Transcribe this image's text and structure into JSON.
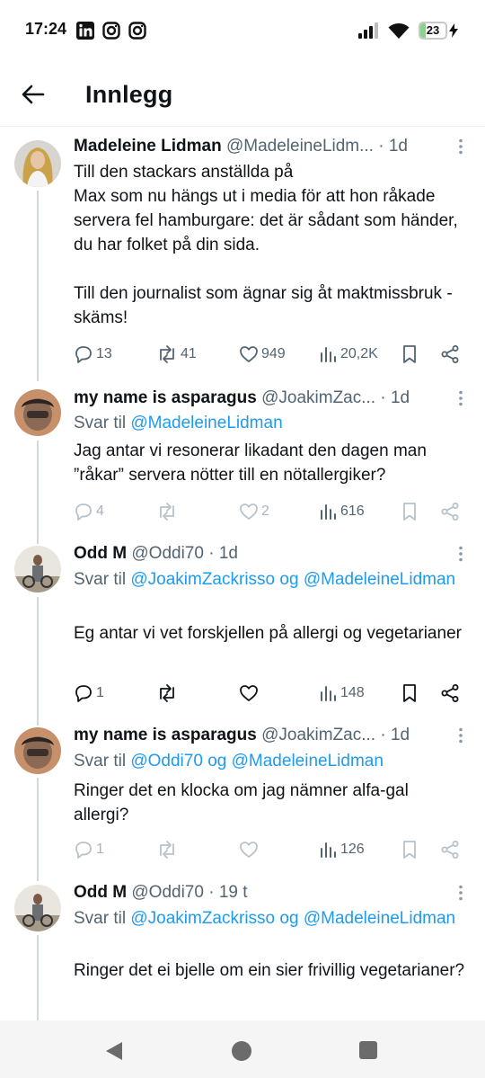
{
  "status_bar": {
    "time": "17:24",
    "battery": "23",
    "battery_level": 0.23,
    "icons": [
      "linkedin-icon",
      "instagram-icon",
      "instagram-icon",
      "signal-icon",
      "wifi-icon",
      "battery-icon",
      "charging-icon"
    ]
  },
  "header": {
    "title": "Innlegg"
  },
  "colors": {
    "link": "#1d9bf0",
    "secondary": "#536471",
    "thread_line": "#cfd9de"
  },
  "posts": [
    {
      "name": "Madeleine Lidman",
      "handle": "@MadeleineLidm...",
      "time": "· 1d",
      "reply_prefix": "",
      "reply_links": [],
      "text": "Till den stackars anställda på\nMax som nu hängs ut i media för att hon råkade servera fel hamburgare: det är sådant som händer, du har folket på din sida.\n\nTill den journalist som ägnar sig åt maktmissbruk - skäms!",
      "replies": "13",
      "reposts": "41",
      "likes": "949",
      "views": "20,2K"
    },
    {
      "name": "my name is asparagus",
      "handle": "@JoakimZac...",
      "time": "· 1d",
      "reply_prefix": "Svar til",
      "reply_links": [
        "@MadeleineLidman"
      ],
      "text": "Jag antar vi resonerar likadant den dagen man ”råkar” servera nötter till en nötallergiker?",
      "replies": "4",
      "reposts": "",
      "likes": "2",
      "views": "616"
    },
    {
      "name": "Odd M",
      "handle": "@Oddi70",
      "time": "· 1d",
      "reply_prefix": "Svar til",
      "reply_links": [
        "@JoakimZackrisso",
        "og",
        "@MadeleineLidman"
      ],
      "text": "Eg antar vi vet forskjellen på allergi og vegetarianer",
      "replies": "1",
      "reposts": "",
      "likes": "",
      "views": "148"
    },
    {
      "name": "my name is asparagus",
      "handle": "@JoakimZac...",
      "time": "· 1d",
      "reply_prefix": "Svar til",
      "reply_links": [
        "@Oddi70",
        "og",
        "@MadeleineLidman"
      ],
      "text": "Ringer det en klocka om jag nämner alfa-gal allergi?",
      "replies": "1",
      "reposts": "",
      "likes": "",
      "views": "126"
    },
    {
      "name": "Odd M",
      "handle": "@Oddi70",
      "time": "· 19 t",
      "reply_prefix": "Svar til",
      "reply_links": [
        "@JoakimZackrisso",
        "og",
        "@MadeleineLidman"
      ],
      "text": "Ringer det ei bjelle om ein sier frivillig vegetarianer?",
      "replies": "",
      "reposts": "",
      "likes": "",
      "views": ""
    }
  ],
  "bottom_nav": {
    "icons": [
      "back-triangle-icon",
      "home-circle-icon",
      "recents-square-icon"
    ]
  }
}
